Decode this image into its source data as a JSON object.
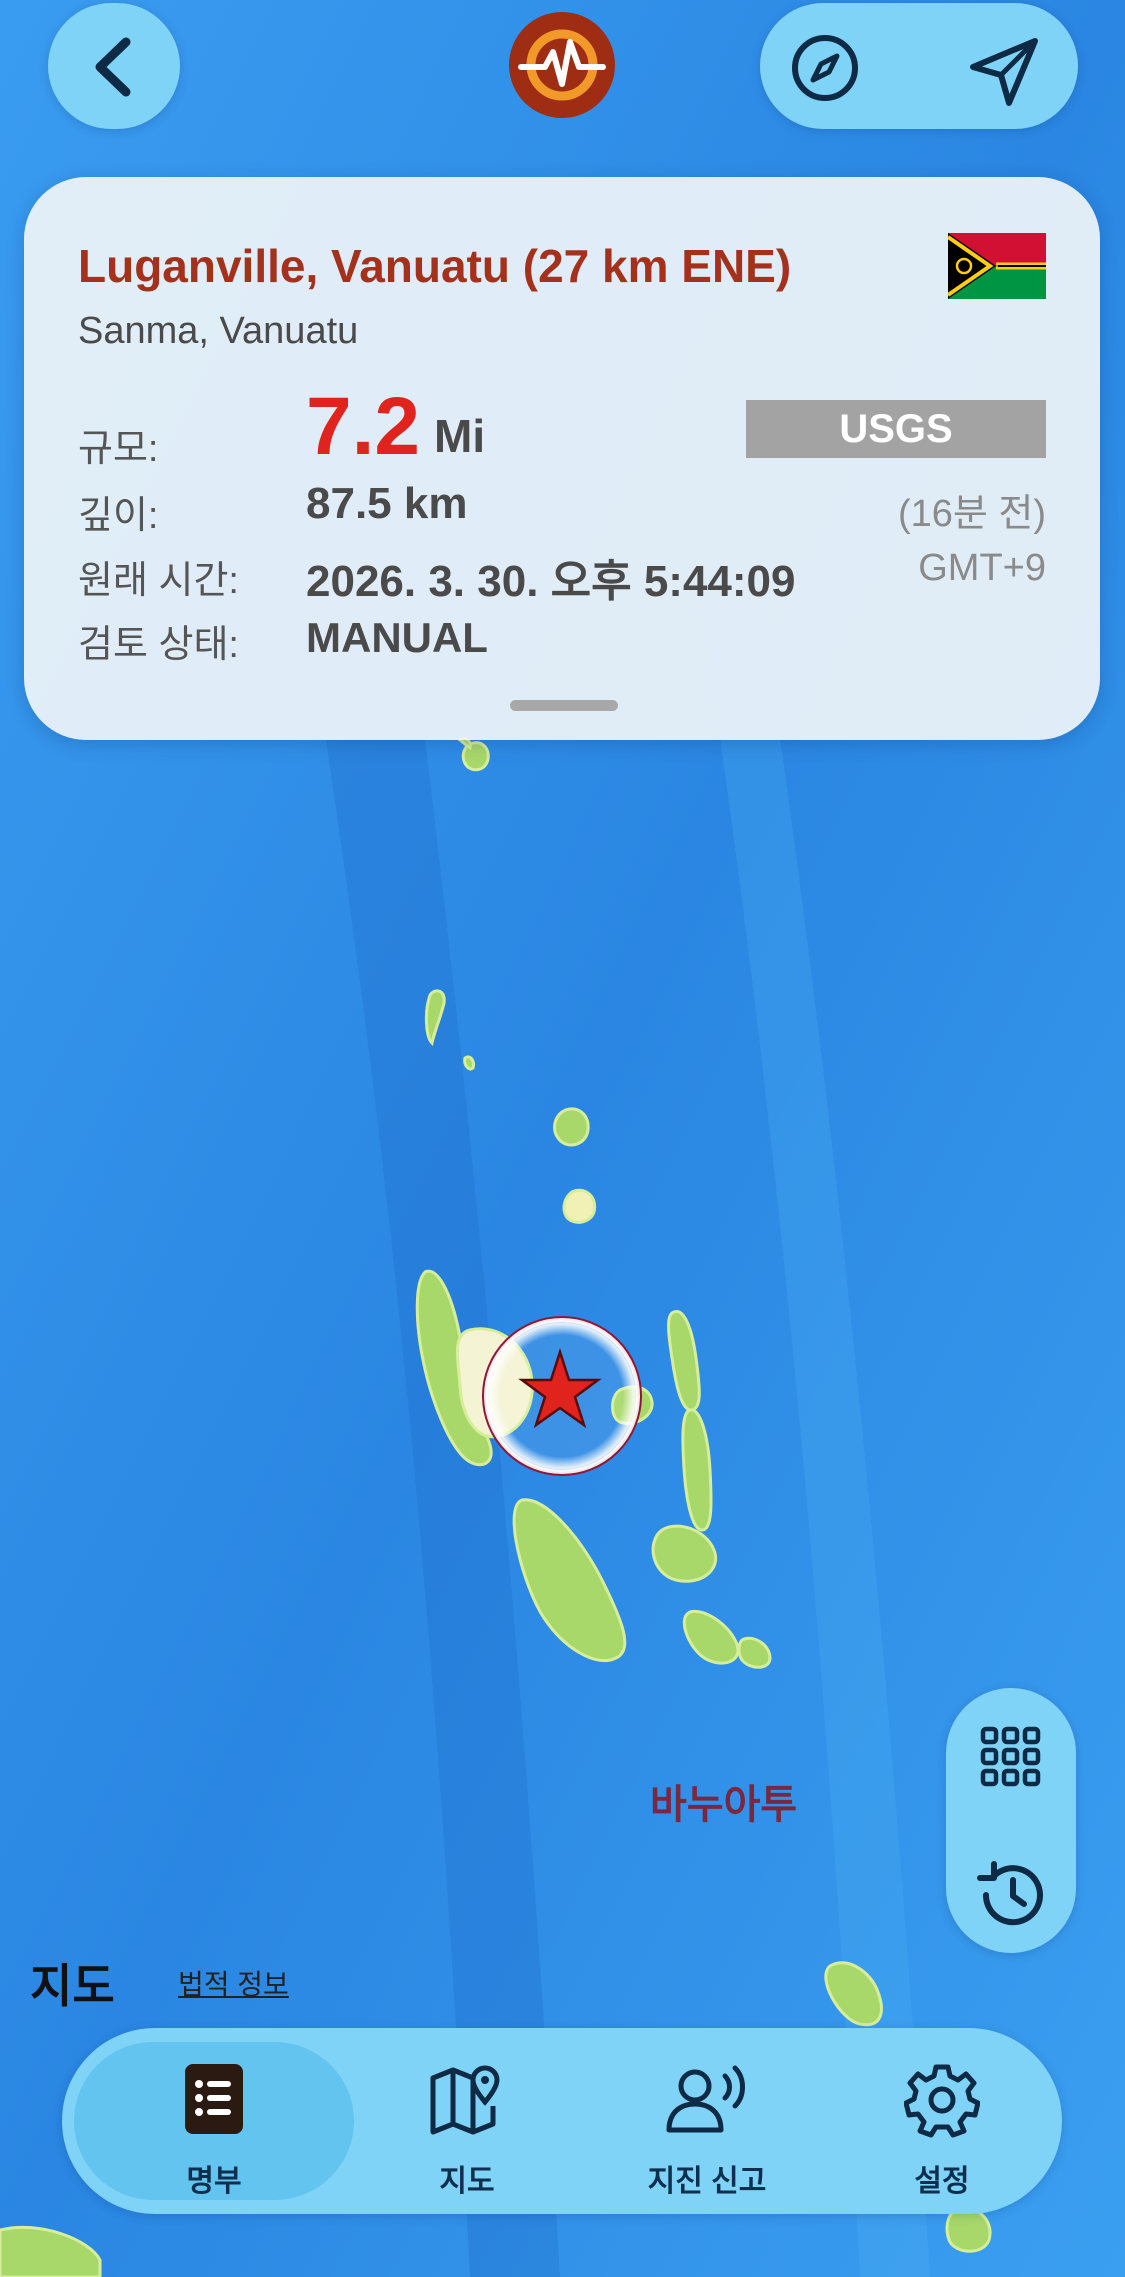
{
  "event": {
    "place": "Luganville, Vanuatu (27 km ENE)",
    "region": "Sanma, Vanuatu",
    "magnitude_label": "규모:",
    "magnitude": "7.2",
    "magnitude_unit": "Mi",
    "source": "USGS",
    "depth_label": "깊이:",
    "depth": "87.5 km",
    "ago": "(16분 전)",
    "time_label": "원래 시간:",
    "time": "2026. 3. 30. 오후 5:44:09",
    "timezone": "GMT+9",
    "status_label": "검토 상태:",
    "status": "MANUAL"
  },
  "map": {
    "country_label": "바누아투",
    "brand": "지도",
    "legal": "법적 정보"
  },
  "tabs": [
    {
      "label": "명부",
      "icon": "list-book-icon",
      "selected": true
    },
    {
      "label": "지도",
      "icon": "map-pin-icon",
      "selected": false
    },
    {
      "label": "지진 신고",
      "icon": "person-report-icon",
      "selected": false
    },
    {
      "label": "설정",
      "icon": "gear-icon",
      "selected": false
    }
  ],
  "colors": {
    "accent_red": "#e1231e",
    "title_red": "#a4311c",
    "button_blue": "#7fd3f7",
    "ocean": "#2f8fe6",
    "land": "#a8d86a"
  }
}
